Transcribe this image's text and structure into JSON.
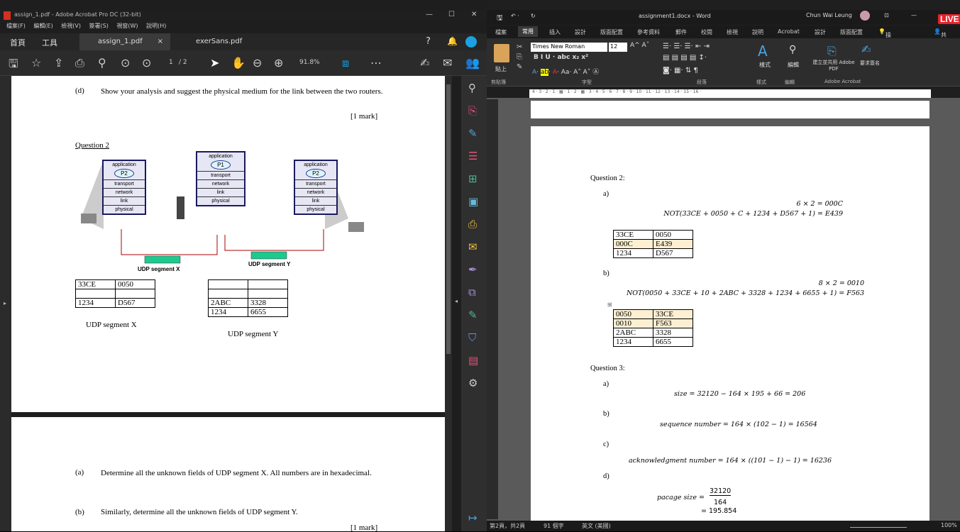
{
  "acrobat": {
    "title": "assign_1.pdf - Adobe Acrobat Pro DC (32-bit)",
    "menu": [
      "檔案(F)",
      "編輯(E)",
      "檢視(V)",
      "簽署(S)",
      "視窗(W)",
      "說明(H)"
    ],
    "home": "首頁",
    "tools": "工具",
    "tabs": [
      {
        "label": "assign_1.pdf",
        "close": "×"
      },
      {
        "label": "exerSans.pdf"
      }
    ],
    "page_num": "1",
    "page_total": "/ 2",
    "zoom": "91.8%",
    "content": {
      "q1d_label": "(d)",
      "q1d_text": "Show your analysis and suggest the physical medium for the link between the two routers.",
      "q1d_mark": "[1 mark]",
      "q2_heading": "Question 2",
      "stack_layers": [
        "transport",
        "network",
        "link",
        "physical"
      ],
      "application": "application",
      "p1": "P1",
      "p2": "P2",
      "seg_x_label": "UDP segment X",
      "seg_y_label": "UDP segment Y",
      "table_x": [
        [
          "33CE",
          "0050"
        ],
        [
          "",
          ""
        ],
        [
          "1234",
          "D567"
        ]
      ],
      "table_y": [
        [
          "",
          ""
        ],
        [
          "",
          ""
        ],
        [
          "2ABC",
          "3328"
        ],
        [
          "1234",
          "6655"
        ]
      ],
      "caption_x": "UDP segment X",
      "caption_y": "UDP segment Y",
      "qa_label": "(a)",
      "qa_text": "Determine all the unknown fields of UDP segment X. All numbers are in hexadecimal.",
      "qb_label": "(b)",
      "qb_text": "Similarly, determine all the unknown fields of UDP segment Y.",
      "qb_mark": "[1 mark]"
    }
  },
  "word": {
    "title": "assignment1.docx - Word",
    "user": "Chun Wai Leung",
    "tabs": [
      "檔案",
      "常用",
      "插入",
      "設計",
      "版面配置",
      "參考資料",
      "郵件",
      "校閱",
      "檢視",
      "說明",
      "Acrobat",
      "設計",
      "版面配置"
    ],
    "tell_me": "操作說明搜",
    "share": "共用",
    "font": "Times New Roman",
    "font_size": "12",
    "groups": [
      "剪貼簿",
      "字型",
      "段落",
      "樣式",
      "編輯",
      "Adobe Acrobat"
    ],
    "paste": "貼上",
    "styles": "樣式",
    "editing": "編輯",
    "acrobat_btn": "建立並共用 Adobe PDF",
    "request_sign": "要求簽名",
    "doc": {
      "q2": "Question 2:",
      "a": "a)",
      "a_eq1": "6 × 2 = 000C",
      "a_eq2": "NOT(33CE + 0050 + C + 1234 + D567 + 1) = E439",
      "a_table": [
        [
          "33CE",
          "0050"
        ],
        [
          "000C",
          "E439"
        ],
        [
          "1234",
          "D567"
        ]
      ],
      "b": "b)",
      "b_eq1": "8 × 2 = 0010",
      "b_eq2": "NOT(0050 + 33CE + 10 + 2ABC + 3328 + 1234 + 6655 + 1) = F563",
      "b_table": [
        [
          "0050",
          "33CE"
        ],
        [
          "0010",
          "F563"
        ],
        [
          "2ABC",
          "3328"
        ],
        [
          "1234",
          "6655"
        ]
      ],
      "q3": "Question 3:",
      "q3a": "a)",
      "q3a_eq": "size = 32120 − 164 × 195 + 66 = 206",
      "q3b": "b)",
      "q3b_eq": "sequence number = 164 × (102 − 1) = 16564",
      "q3c": "c)",
      "q3c_eq": "acknowledgment number = 164 × ((101 − 1) − 1) = 16236",
      "q3d": "d)",
      "q3d_lhs": "pacage size =",
      "q3d_num": "32120",
      "q3d_den": "164",
      "q3d_res": "= 195.854"
    },
    "status": {
      "page": "第2頁，共2頁",
      "words": "91 個字",
      "lang": "英文 (美國)",
      "zoom": "100%"
    }
  },
  "live": "LIVE"
}
